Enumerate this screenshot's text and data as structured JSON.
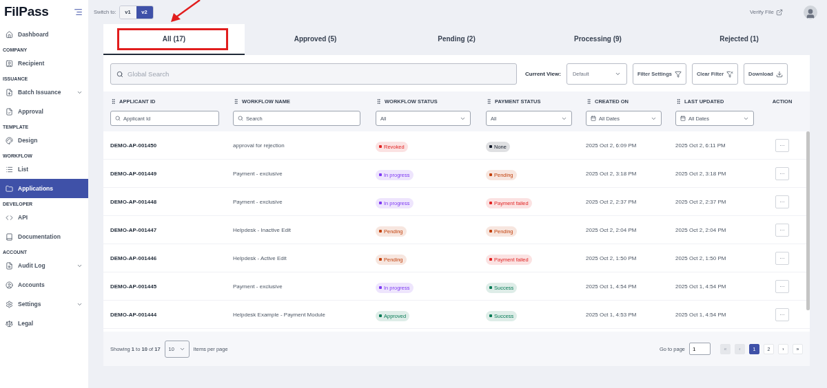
{
  "brand": {
    "name": "FilPass"
  },
  "sidebar": {
    "groups": [
      {
        "items": [
          {
            "label": "Dashboard",
            "selected": false
          }
        ]
      },
      {
        "heading": "COMPANY",
        "items": [
          {
            "label": "Recipient",
            "selected": false
          }
        ]
      },
      {
        "heading": "ISSUANCE",
        "items": [
          {
            "label": "Batch Issuance",
            "selected": false,
            "expandable": true
          },
          {
            "label": "Approval",
            "selected": false
          }
        ]
      },
      {
        "heading": "TEMPLATE",
        "items": [
          {
            "label": "Design",
            "selected": false
          }
        ]
      },
      {
        "heading": "WORKFLOW",
        "items": [
          {
            "label": "List",
            "selected": false
          },
          {
            "label": "Applications",
            "selected": true
          }
        ]
      },
      {
        "heading": "DEVELOPER",
        "items": [
          {
            "label": "API",
            "selected": false
          },
          {
            "label": "Documentation",
            "selected": false
          }
        ]
      },
      {
        "heading": "ACCOUNT",
        "items": [
          {
            "label": "Audit Log",
            "selected": false,
            "expandable": true
          },
          {
            "label": "Accounts",
            "selected": false
          },
          {
            "label": "Settings",
            "selected": false,
            "expandable": true
          },
          {
            "label": "Legal",
            "selected": false
          }
        ]
      }
    ]
  },
  "topbar": {
    "switch_label": "Switch to:",
    "versions": [
      {
        "label": "v1",
        "selected": false
      },
      {
        "label": "v2",
        "selected": true
      }
    ],
    "verify_link": "Verify File"
  },
  "tabs": [
    {
      "label": "All (17)",
      "selected": true,
      "highlighted": true
    },
    {
      "label": "Approved (5)",
      "selected": false,
      "highlighted": false
    },
    {
      "label": "Pending (2)",
      "selected": false,
      "highlighted": false
    },
    {
      "label": "Processing (9)",
      "selected": false,
      "highlighted": false
    },
    {
      "label": "Rejected (1)",
      "selected": false,
      "highlighted": false
    }
  ],
  "toolbar": {
    "search_placeholder": "Global Search",
    "view_label": "Current View:",
    "view_value": "Default",
    "buttons": [
      "Filter Settings",
      "Clear Filter",
      "Download"
    ]
  },
  "table": {
    "columns": [
      {
        "title": "APPLICANT ID",
        "filter": {
          "kind": "search",
          "placeholder": "Applicant Id"
        }
      },
      {
        "title": "WORKFLOW NAME",
        "filter": {
          "kind": "search",
          "placeholder": "Search"
        }
      },
      {
        "title": "WORKFLOW STATUS",
        "filter": {
          "kind": "select",
          "value": "All"
        }
      },
      {
        "title": "PAYMENT STATUS",
        "filter": {
          "kind": "select",
          "value": "All"
        }
      },
      {
        "title": "CREATED ON",
        "filter": {
          "kind": "date",
          "value": "All Dates"
        }
      },
      {
        "title": "LAST UPDATED",
        "filter": {
          "kind": "date",
          "value": "All Dates"
        }
      },
      {
        "title": "ACTION"
      }
    ],
    "rows": [
      {
        "id": "DEMO-AP-001450",
        "workflow": "approval for rejection",
        "workflow_status": {
          "label": "Revoked",
          "color": "#e02424"
        },
        "payment_status": {
          "label": "None",
          "color": "#111827"
        },
        "created": "2025 Oct 2, 6:09 PM",
        "updated": "2025 Oct 2, 6:11 PM",
        "action": "···"
      },
      {
        "id": "DEMO-AP-001449",
        "workflow": "Payment - exclusive",
        "workflow_status": {
          "label": "In progress",
          "color": "#7e3af2"
        },
        "payment_status": {
          "label": "Pending",
          "color": "#c2410c"
        },
        "created": "2025 Oct 2, 3:18 PM",
        "updated": "2025 Oct 2, 3:18 PM",
        "action": "···"
      },
      {
        "id": "DEMO-AP-001448",
        "workflow": "Payment - exclusive",
        "workflow_status": {
          "label": "In progress",
          "color": "#7e3af2"
        },
        "payment_status": {
          "label": "Payment failed",
          "color": "#e02424"
        },
        "created": "2025 Oct 2, 2:37 PM",
        "updated": "2025 Oct 2, 2:37 PM",
        "action": "···"
      },
      {
        "id": "DEMO-AP-001447",
        "workflow": "Helpdesk - Inactive Edit",
        "workflow_status": {
          "label": "Pending",
          "color": "#c2410c"
        },
        "payment_status": {
          "label": "Pending",
          "color": "#c2410c"
        },
        "created": "2025 Oct 2, 2:04 PM",
        "updated": "2025 Oct 2, 2:04 PM",
        "action": "···"
      },
      {
        "id": "DEMO-AP-001446",
        "workflow": "Helpdesk - Active Edit",
        "workflow_status": {
          "label": "Pending",
          "color": "#c2410c"
        },
        "payment_status": {
          "label": "Payment failed",
          "color": "#e02424"
        },
        "created": "2025 Oct 2, 1:50 PM",
        "updated": "2025 Oct 2, 1:50 PM",
        "action": "···"
      },
      {
        "id": "DEMO-AP-001445",
        "workflow": "Payment - exclusive",
        "workflow_status": {
          "label": "In progress",
          "color": "#7e3af2"
        },
        "payment_status": {
          "label": "Success",
          "color": "#057a55"
        },
        "created": "2025 Oct 1, 4:54 PM",
        "updated": "2025 Oct 1, 4:54 PM",
        "action": "···"
      },
      {
        "id": "DEMO-AP-001444",
        "workflow": "Helpdesk Example - Payment Module",
        "workflow_status": {
          "label": "Approved",
          "color": "#057a55"
        },
        "payment_status": {
          "label": "Success",
          "color": "#057a55"
        },
        "created": "2025 Oct 1, 4:53 PM",
        "updated": "2025 Oct 1, 4:54 PM",
        "action": "···"
      }
    ]
  },
  "footer": {
    "showing": "Showing **1** to **10** of **17**",
    "page_size": "10",
    "per_page_label": "Items per page",
    "goto_label": "Go to page",
    "goto_value": "1",
    "pager": [
      {
        "label": "«",
        "selected": false,
        "disabled": true
      },
      {
        "label": "‹",
        "selected": false,
        "disabled": true
      },
      {
        "label": "1",
        "selected": true,
        "disabled": false
      },
      {
        "label": "2",
        "selected": false,
        "disabled": false
      },
      {
        "label": "›",
        "selected": false,
        "disabled": false
      },
      {
        "label": "»",
        "selected": false,
        "disabled": false
      }
    ]
  }
}
